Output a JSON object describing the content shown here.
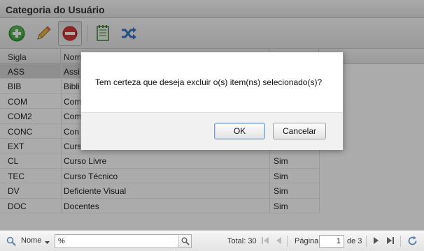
{
  "window": {
    "title": "Categoria do Usuário"
  },
  "toolbar": {
    "buttons": [
      {
        "name": "add",
        "icon": "plus-circle-icon",
        "color": "#3fa63f"
      },
      {
        "name": "edit",
        "icon": "pencil-icon",
        "color": "#d9a441"
      },
      {
        "name": "delete",
        "icon": "no-entry-icon",
        "color": "#d63a3a",
        "pressed": true
      },
      {
        "name": "document",
        "icon": "notepad-icon",
        "color": "#3f7d3f"
      },
      {
        "name": "shuffle",
        "icon": "shuffle-icon",
        "color": "#3a77c9"
      }
    ]
  },
  "grid": {
    "columns": [
      "Sigla",
      "Nome"
    ],
    "rows": [
      {
        "sigla": "ASS",
        "nome": "Assi",
        "flag": "",
        "selected": true
      },
      {
        "sigla": "BIB",
        "nome": "Bibli",
        "flag": ""
      },
      {
        "sigla": "COM",
        "nome": "Com",
        "flag": ""
      },
      {
        "sigla": "COM2",
        "nome": "Com",
        "flag": ""
      },
      {
        "sigla": "CONC",
        "nome": "Con",
        "flag": ""
      },
      {
        "sigla": "EXT",
        "nome": "Curs",
        "flag": ""
      },
      {
        "sigla": "CL",
        "nome": "Curso Livre",
        "flag": "Sim"
      },
      {
        "sigla": "TEC",
        "nome": "Curso Técnico",
        "flag": "Sim"
      },
      {
        "sigla": "DV",
        "nome": "Deficiente Visual",
        "flag": "Sim"
      },
      {
        "sigla": "DOC",
        "nome": "Docentes",
        "flag": "Sim"
      }
    ]
  },
  "dialog": {
    "message": "Tem certeza que deseja excluir o(s) item(ns) selecionado(s)?",
    "ok_label": "OK",
    "cancel_label": "Cancelar"
  },
  "statusbar": {
    "search_field_label": "Nome",
    "search_value": "%",
    "total_label": "Total: 30",
    "page_label": "Página",
    "page_value": "1",
    "page_of": "de 3"
  }
}
